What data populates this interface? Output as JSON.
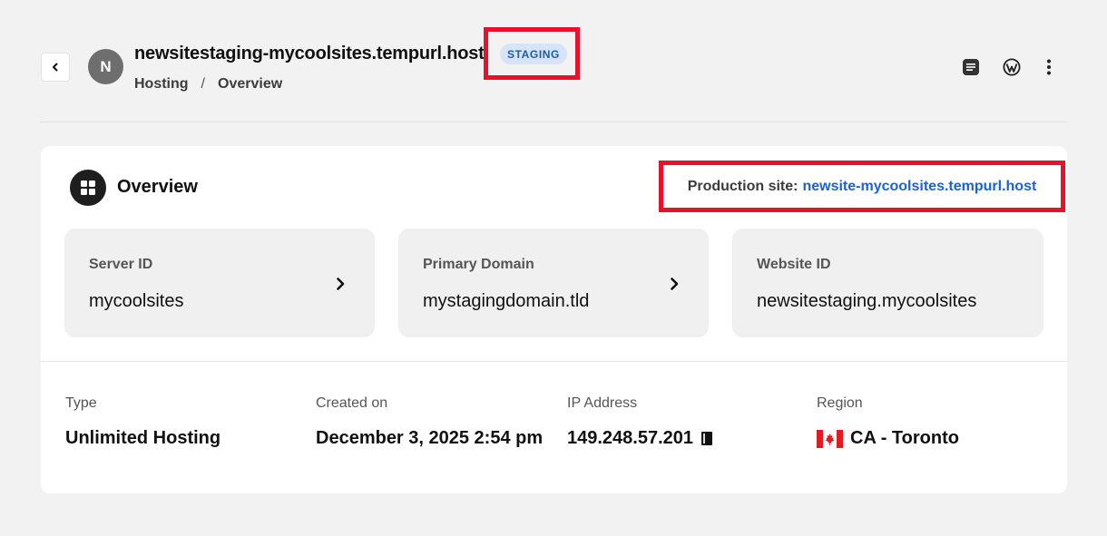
{
  "header": {
    "avatar_initial": "N",
    "site_title": "newsitestaging-mycoolsites.tempurl.host",
    "badge": "STAGING",
    "breadcrumb": [
      "Hosting",
      "/",
      "Overview"
    ],
    "actions": [
      "notes-icon",
      "wordpress-icon",
      "more-vertical-icon"
    ]
  },
  "overview": {
    "title": "Overview",
    "production_label": "Production site:",
    "production_link": "newsite-mycoolsites.tempurl.host",
    "tiles": [
      {
        "label": "Server ID",
        "value": "mycoolsites",
        "has_arrow": true
      },
      {
        "label": "Primary Domain",
        "value": "mystagingdomain.tld",
        "has_arrow": true
      },
      {
        "label": "Website ID",
        "value": "newsitestaging.mycoolsites",
        "has_arrow": false
      }
    ],
    "info": [
      {
        "label": "Type",
        "value": "Unlimited Hosting"
      },
      {
        "label": "Created on",
        "value": "December 3, 2025 2:54 pm"
      },
      {
        "label": "IP Address",
        "value": "149.248.57.201"
      },
      {
        "label": "Region",
        "value": "CA - Toronto"
      }
    ]
  },
  "colors": {
    "highlight_border": "#e8102a",
    "link": "#1a62d6",
    "badge_bg": "#d7e4f7",
    "badge_text": "#1f5aa8"
  }
}
